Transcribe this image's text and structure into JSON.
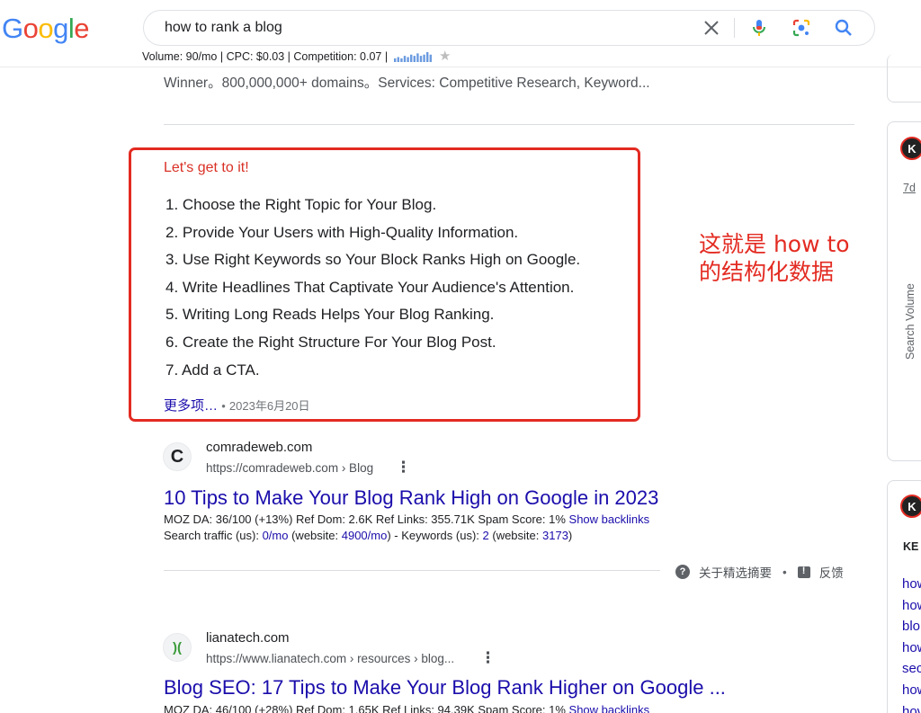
{
  "header": {
    "logo_letters": [
      {
        "ch": "G",
        "color": "#4285F4"
      },
      {
        "ch": "o",
        "color": "#EA4335"
      },
      {
        "ch": "o",
        "color": "#FBBC05"
      },
      {
        "ch": "g",
        "color": "#4285F4"
      },
      {
        "ch": "l",
        "color": "#34A853"
      },
      {
        "ch": "e",
        "color": "#EA4335"
      }
    ],
    "query": "how to rank a blog",
    "icons": {
      "clear": "close-icon",
      "voice": "microphone-icon",
      "lens": "camera-lens-icon",
      "search": "search-icon"
    },
    "metrics": "Volume: 90/mo | CPC: $0.03 | Competition: 0.07 |",
    "trend": [
      3,
      4,
      3,
      5,
      4,
      6,
      5,
      7,
      5,
      6,
      8,
      6
    ]
  },
  "results": {
    "prev_snippet": "Winner。800,000,000+ domains。Services: Competitive Research, Keyword...",
    "featured": {
      "heading": "Let's get to it!",
      "items": [
        "1. Choose the Right Topic for Your Blog.",
        "2. Provide Your Users with High-Quality Information.",
        "3. Use Right Keywords so Your Block Ranks High on Google.",
        "4. Write Headlines That Captivate Your Audience's Attention.",
        "5. Writing Long Reads Helps Your Blog Ranking.",
        "6. Create the Right Structure For Your Blog Post.",
        "7. Add a CTA."
      ],
      "more": "更多项…",
      "separator": "•",
      "date": "2023年6月20日"
    },
    "annotation": [
      "这就是 how to",
      "的结构化数据"
    ],
    "result1": {
      "icon_letter": "C",
      "site": "comradeweb.com",
      "url": "https://comradeweb.com › Blog",
      "title": "10 Tips to Make Your Blog Rank High on Google in 2023",
      "seo_prefix": "MOZ DA: 36/100 (+13%)   Ref Dom: 2.6K    Ref Links: 355.71K    Spam Score: 1%",
      "show_backlinks": "Show backlinks",
      "traffic_a": "Search traffic (us): ",
      "traffic_v1": "0/mo",
      "traffic_b": " (website: ",
      "traffic_v2": "4900/mo",
      "traffic_c": ") - Keywords (us): ",
      "traffic_v3": "2",
      "traffic_d": " (website: ",
      "traffic_v4": "3173",
      "traffic_e": ")"
    },
    "about_snippets": "关于精选摘要",
    "feedback": "反馈",
    "result2": {
      "icon_letter": ")(",
      "site": "lianatech.com",
      "url": "https://www.lianatech.com › resources › blog...",
      "title": "Blog SEO: 17 Tips to Make Your Blog Rank Higher on Google ...",
      "seo_prefix": "MOZ DA: 46/100 (+28%)   Ref Dom: 1.65K    Ref Links: 94.39K    Spam Score: 1%",
      "show_backlinks": "Show backlinks"
    }
  },
  "right_panel": {
    "badge": "K",
    "range": "7d",
    "axis_label": "Search Volume",
    "keywords_heading": "KE",
    "links": [
      "how",
      "how",
      "blo",
      "how",
      "sec",
      "how",
      "hov"
    ]
  }
}
